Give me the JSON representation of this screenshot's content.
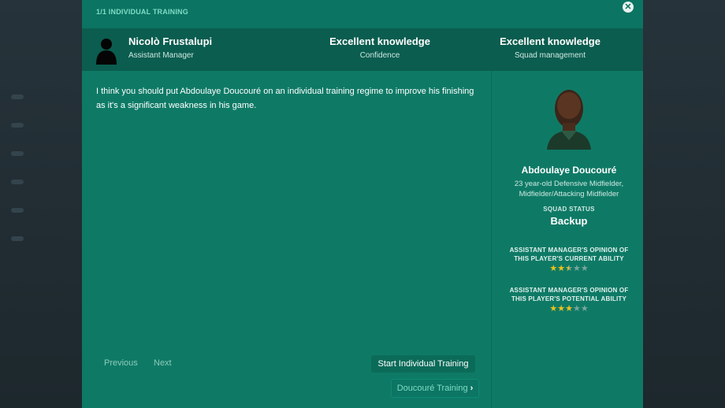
{
  "dialog": {
    "breadcrumb": "1/1 INDIVIDUAL TRAINING"
  },
  "staff": {
    "name": "Nicolò Frustalupi",
    "role": "Assistant Manager"
  },
  "knowledge": [
    {
      "title": "Excellent knowledge",
      "subtitle": "Confidence"
    },
    {
      "title": "Excellent knowledge",
      "subtitle": "Squad management"
    }
  ],
  "message": {
    "text": "I think you should put Abdoulaye Doucouré on an individual training regime to improve his finishing as it's a significant weakness in his game."
  },
  "navigation": {
    "previous_label": "Previous",
    "next_label": "Next"
  },
  "actions": {
    "start_training_label": "Start Individual Training",
    "player_training_label": "Doucouré Training"
  },
  "player": {
    "name": "Abdoulaye Doucouré",
    "description_line1": "23 year-old Defensive Midfielder,",
    "description_line2": "Midfielder/Attacking Midfielder",
    "squad_status_label": "SQUAD STATUS",
    "squad_status": "Backup",
    "current_ability_label_line1": "ASSISTANT MANAGER'S OPINION OF",
    "current_ability_label_line2": "THIS PLAYER'S CURRENT ABILITY",
    "current_ability_stars": 2.5,
    "potential_ability_label_line1": "ASSISTANT MANAGER'S OPINION OF",
    "potential_ability_label_line2": "THIS PLAYER'S POTENTIAL ABILITY",
    "potential_ability_stars": 3,
    "max_stars": 5
  },
  "icons": {
    "close": "close-icon",
    "chevron": "chevron-right-icon",
    "star": "star-icon"
  },
  "colors": {
    "panel": "#0e7a66",
    "header": "#0b5d4f",
    "accent": "#7fdcc7",
    "star": "#f1c21b"
  }
}
